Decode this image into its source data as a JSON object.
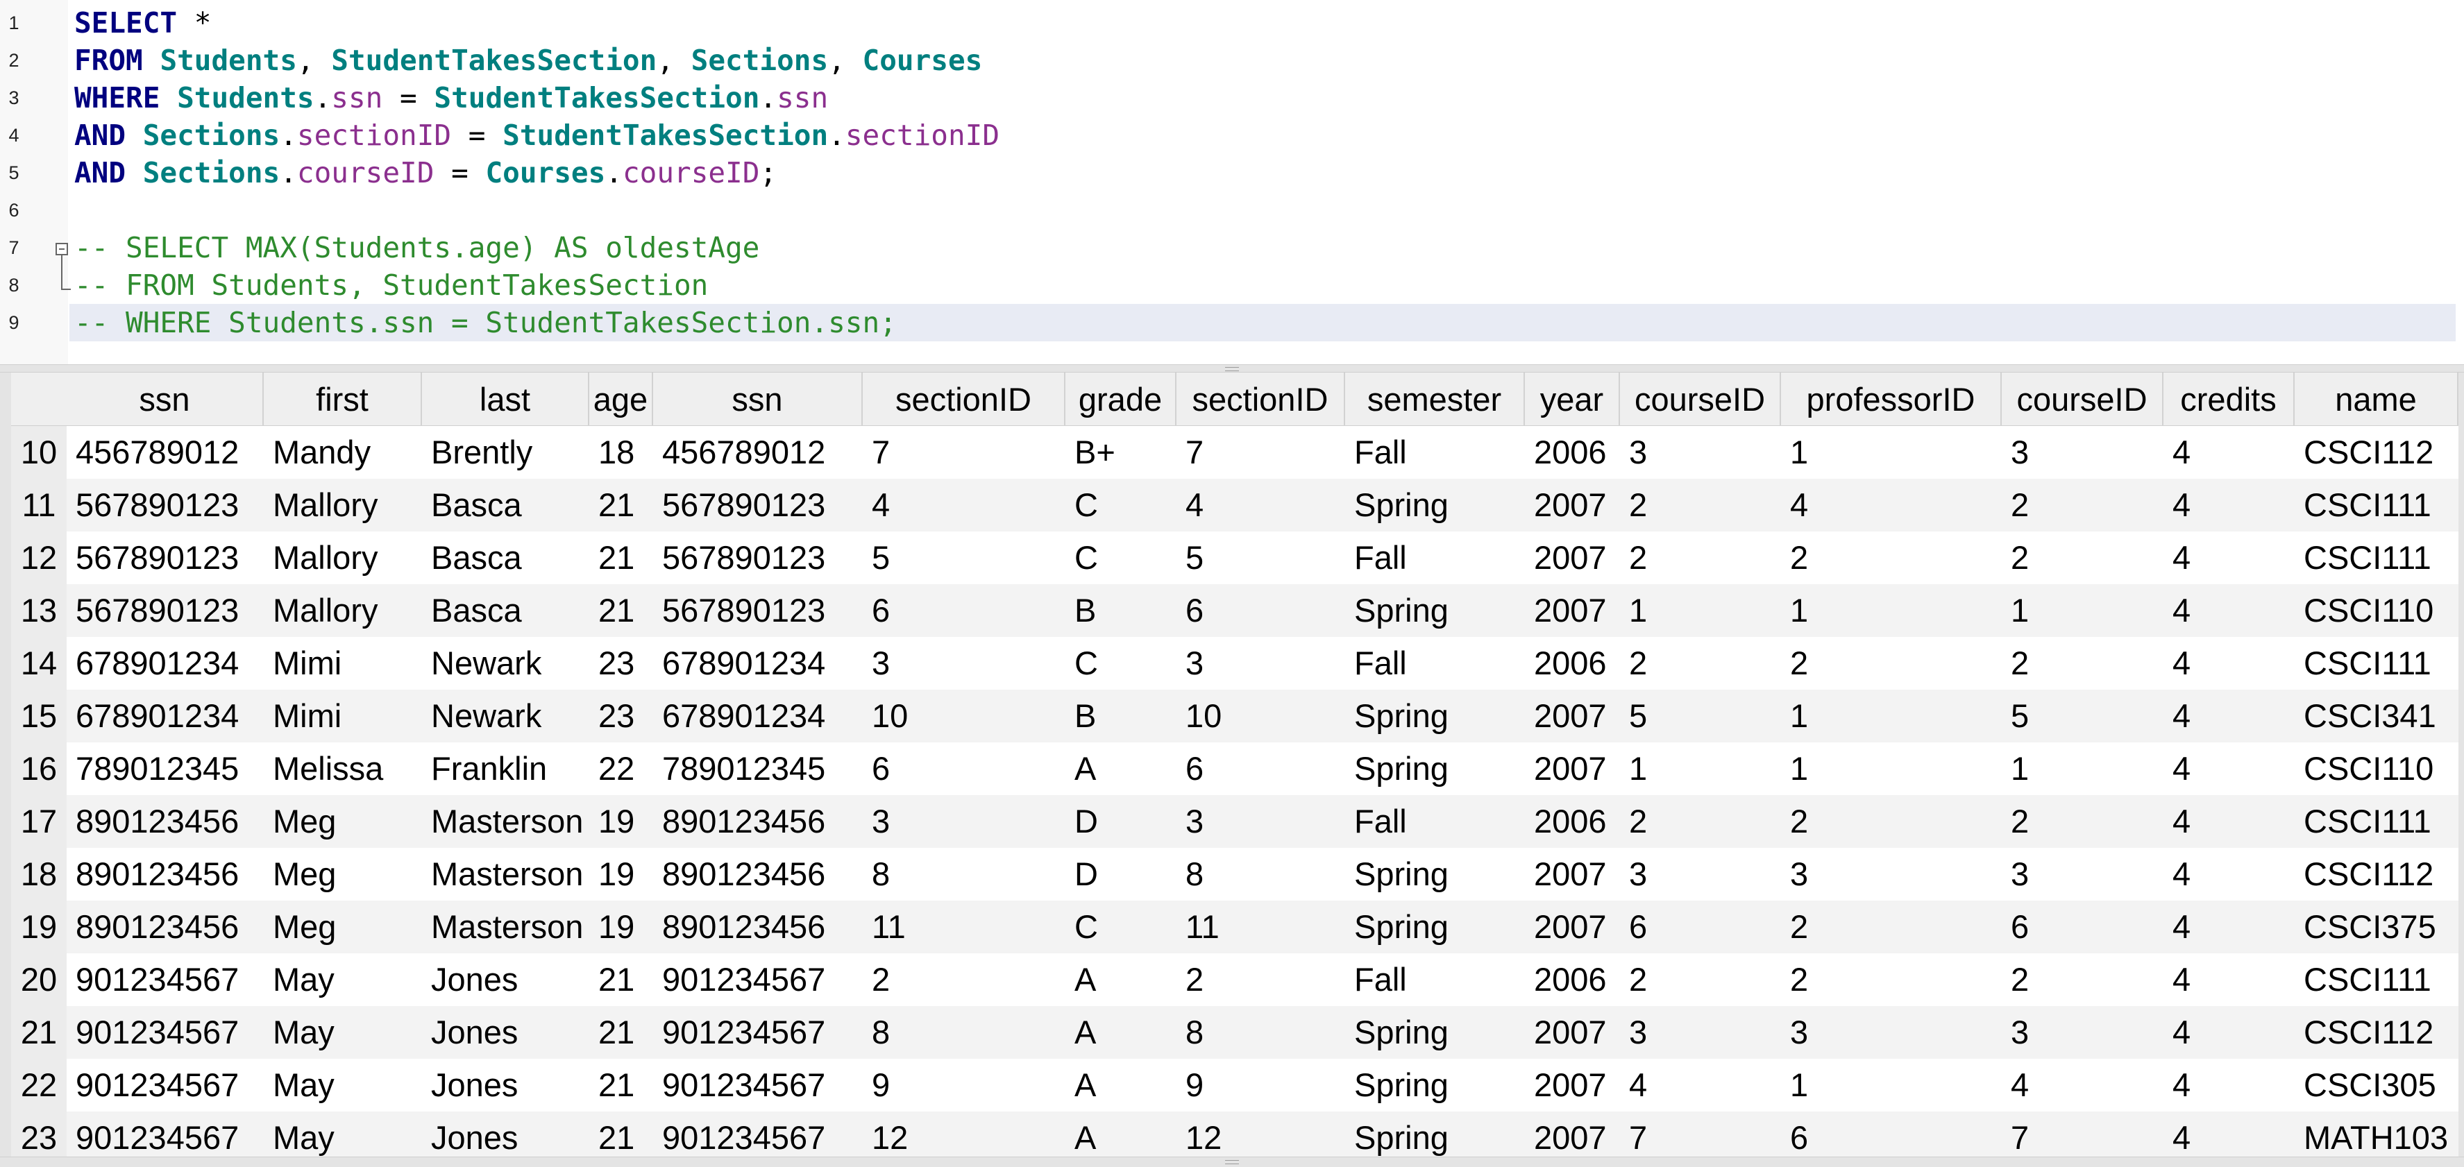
{
  "editor": {
    "lines": [
      {
        "num": "1",
        "tokens": [
          [
            "kw",
            "SELECT"
          ],
          [
            "pun",
            " *"
          ]
        ]
      },
      {
        "num": "2",
        "tokens": [
          [
            "kw",
            "FROM"
          ],
          [
            "pun",
            " "
          ],
          [
            "tbl",
            "Students"
          ],
          [
            "pun",
            ", "
          ],
          [
            "tbl",
            "StudentTakesSection"
          ],
          [
            "pun",
            ", "
          ],
          [
            "tbl",
            "Sections"
          ],
          [
            "pun",
            ", "
          ],
          [
            "tbl",
            "Courses"
          ]
        ]
      },
      {
        "num": "3",
        "tokens": [
          [
            "kw",
            "WHERE"
          ],
          [
            "pun",
            " "
          ],
          [
            "tbl",
            "Students"
          ],
          [
            "pun",
            "."
          ],
          [
            "col",
            "ssn"
          ],
          [
            "pun",
            " = "
          ],
          [
            "tbl",
            "StudentTakesSection"
          ],
          [
            "pun",
            "."
          ],
          [
            "col",
            "ssn"
          ]
        ]
      },
      {
        "num": "4",
        "tokens": [
          [
            "kw",
            "AND"
          ],
          [
            "pun",
            " "
          ],
          [
            "tbl",
            "Sections"
          ],
          [
            "pun",
            "."
          ],
          [
            "col",
            "sectionID"
          ],
          [
            "pun",
            " = "
          ],
          [
            "tbl",
            "StudentTakesSection"
          ],
          [
            "pun",
            "."
          ],
          [
            "col",
            "sectionID"
          ]
        ]
      },
      {
        "num": "5",
        "tokens": [
          [
            "kw",
            "AND"
          ],
          [
            "pun",
            " "
          ],
          [
            "tbl",
            "Sections"
          ],
          [
            "pun",
            "."
          ],
          [
            "col",
            "courseID"
          ],
          [
            "pun",
            " = "
          ],
          [
            "tbl",
            "Courses"
          ],
          [
            "pun",
            "."
          ],
          [
            "col",
            "courseID"
          ],
          [
            "pun",
            ";"
          ]
        ]
      },
      {
        "num": "6",
        "tokens": []
      },
      {
        "num": "7",
        "tokens": [
          [
            "cmt",
            "-- SELECT MAX(Students.age) AS oldestAge"
          ]
        ]
      },
      {
        "num": "8",
        "tokens": [
          [
            "cmt",
            "-- FROM Students, StudentTakesSection"
          ]
        ]
      },
      {
        "num": "9",
        "tokens": [
          [
            "cmt",
            "-- WHERE Students.ssn = StudentTakesSection.ssn;"
          ]
        ]
      }
    ]
  },
  "results": {
    "columns": [
      "ssn",
      "first",
      "last",
      "age",
      "ssn",
      "sectionID",
      "grade",
      "sectionID",
      "semester",
      "year",
      "courseID",
      "professorID",
      "courseID",
      "credits",
      "name"
    ],
    "rows": [
      {
        "num": "10",
        "cells": [
          "456789012",
          "Mandy",
          "Brently",
          "18",
          "456789012",
          "7",
          "B+",
          "7",
          "Fall",
          "2006",
          "3",
          "1",
          "3",
          "4",
          "CSCI112"
        ]
      },
      {
        "num": "11",
        "cells": [
          "567890123",
          "Mallory",
          "Basca",
          "21",
          "567890123",
          "4",
          "C",
          "4",
          "Spring",
          "2007",
          "2",
          "4",
          "2",
          "4",
          "CSCI111"
        ]
      },
      {
        "num": "12",
        "cells": [
          "567890123",
          "Mallory",
          "Basca",
          "21",
          "567890123",
          "5",
          "C",
          "5",
          "Fall",
          "2007",
          "2",
          "2",
          "2",
          "4",
          "CSCI111"
        ]
      },
      {
        "num": "13",
        "cells": [
          "567890123",
          "Mallory",
          "Basca",
          "21",
          "567890123",
          "6",
          "B",
          "6",
          "Spring",
          "2007",
          "1",
          "1",
          "1",
          "4",
          "CSCI110"
        ]
      },
      {
        "num": "14",
        "cells": [
          "678901234",
          "Mimi",
          "Newark",
          "23",
          "678901234",
          "3",
          "C",
          "3",
          "Fall",
          "2006",
          "2",
          "2",
          "2",
          "4",
          "CSCI111"
        ]
      },
      {
        "num": "15",
        "cells": [
          "678901234",
          "Mimi",
          "Newark",
          "23",
          "678901234",
          "10",
          "B",
          "10",
          "Spring",
          "2007",
          "5",
          "1",
          "5",
          "4",
          "CSCI341"
        ]
      },
      {
        "num": "16",
        "cells": [
          "789012345",
          "Melissa",
          "Franklin",
          "22",
          "789012345",
          "6",
          "A",
          "6",
          "Spring",
          "2007",
          "1",
          "1",
          "1",
          "4",
          "CSCI110"
        ]
      },
      {
        "num": "17",
        "cells": [
          "890123456",
          "Meg",
          "Masterson",
          "19",
          "890123456",
          "3",
          "D",
          "3",
          "Fall",
          "2006",
          "2",
          "2",
          "2",
          "4",
          "CSCI111"
        ]
      },
      {
        "num": "18",
        "cells": [
          "890123456",
          "Meg",
          "Masterson",
          "19",
          "890123456",
          "8",
          "D",
          "8",
          "Spring",
          "2007",
          "3",
          "3",
          "3",
          "4",
          "CSCI112"
        ]
      },
      {
        "num": "19",
        "cells": [
          "890123456",
          "Meg",
          "Masterson",
          "19",
          "890123456",
          "11",
          "C",
          "11",
          "Spring",
          "2007",
          "6",
          "2",
          "6",
          "4",
          "CSCI375"
        ]
      },
      {
        "num": "20",
        "cells": [
          "901234567",
          "May",
          "Jones",
          "21",
          "901234567",
          "2",
          "A",
          "2",
          "Fall",
          "2006",
          "2",
          "2",
          "2",
          "4",
          "CSCI111"
        ]
      },
      {
        "num": "21",
        "cells": [
          "901234567",
          "May",
          "Jones",
          "21",
          "901234567",
          "8",
          "A",
          "8",
          "Spring",
          "2007",
          "3",
          "3",
          "3",
          "4",
          "CSCI112"
        ]
      },
      {
        "num": "22",
        "cells": [
          "901234567",
          "May",
          "Jones",
          "21",
          "901234567",
          "9",
          "A",
          "9",
          "Spring",
          "2007",
          "4",
          "1",
          "4",
          "4",
          "CSCI305"
        ]
      },
      {
        "num": "23",
        "cells": [
          "901234567",
          "May",
          "Jones",
          "21",
          "901234567",
          "12",
          "A",
          "12",
          "Spring",
          "2007",
          "7",
          "6",
          "7",
          "4",
          "MATH103"
        ]
      }
    ]
  }
}
